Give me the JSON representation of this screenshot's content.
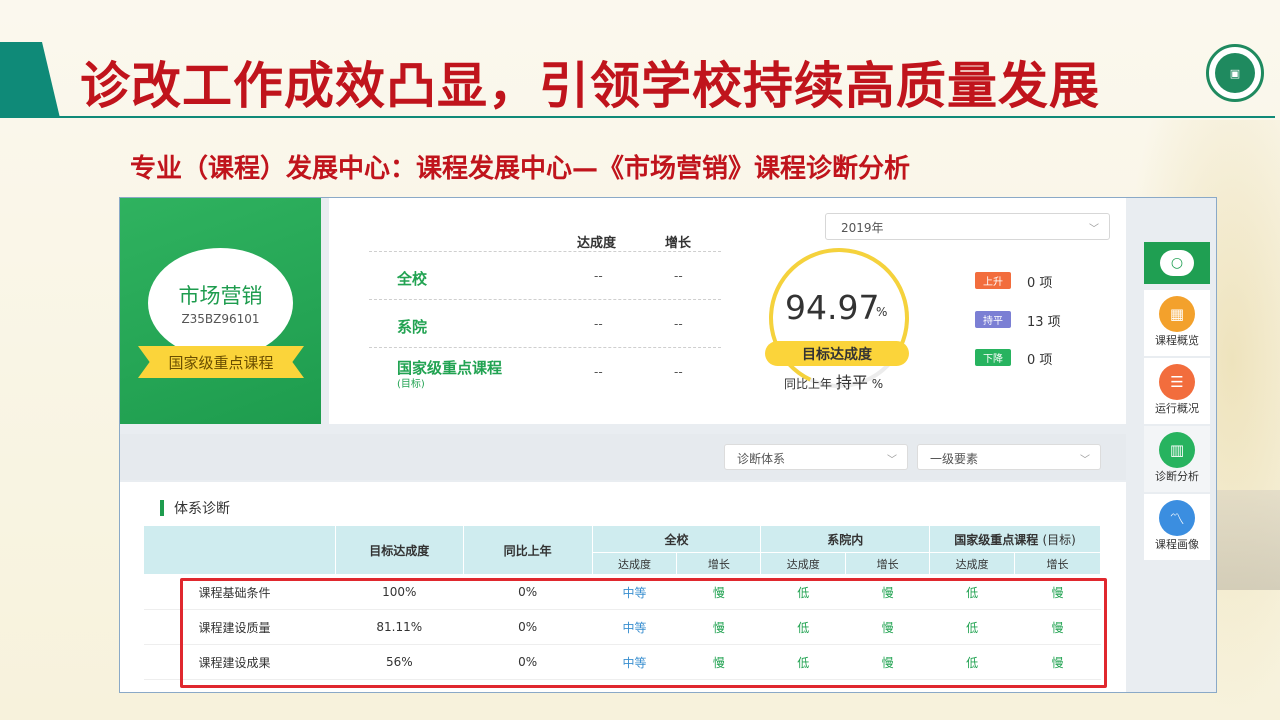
{
  "slide": {
    "title": "诊改工作成效凸显，引领学校持续高质量发展",
    "subtitle": "专业（课程）发展中心：课程发展中心—《市场营销》课程诊断分析"
  },
  "course_card": {
    "name": "市场营销",
    "code": "Z35BZ96101",
    "tag": "国家级重点课程"
  },
  "stats": {
    "col_headers": [
      "达成度",
      "增长"
    ],
    "rows": [
      {
        "label": "全校",
        "sub": "",
        "achievement": "--",
        "growth": "--"
      },
      {
        "label": "系院",
        "sub": "",
        "achievement": "--",
        "growth": "--"
      },
      {
        "label": "国家级重点课程",
        "sub": "(目标)",
        "achievement": "--",
        "growth": "--"
      }
    ]
  },
  "year_select": {
    "value": "2019年"
  },
  "gauge": {
    "value": "94.97",
    "unit": "%",
    "badge": "目标达成度",
    "compare_prefix": "同比上年",
    "compare_value": "持平",
    "compare_unit": "%"
  },
  "trends": [
    {
      "badge": "上升",
      "count": "0 项",
      "color": "#f26d3d"
    },
    {
      "badge": "持平",
      "count": "13 项",
      "color": "#7b7fd4"
    },
    {
      "badge": "下降",
      "count": "0 项",
      "color": "#27b35f"
    }
  ],
  "side_nav": [
    {
      "label": "课程概览",
      "icon": "grid-icon",
      "color": "#f3a12c"
    },
    {
      "label": "运行概况",
      "icon": "list-icon",
      "color": "#f26d3d"
    },
    {
      "label": "诊断分析",
      "icon": "bar-chart-icon",
      "color": "#27b35f"
    },
    {
      "label": "课程画像",
      "icon": "trend-icon",
      "color": "#3b8ee0"
    }
  ],
  "filters": {
    "system": "诊断体系",
    "level": "一级要素"
  },
  "table": {
    "section_title": "体系诊断",
    "headers": {
      "target": "目标达成度",
      "yoy": "同比上年",
      "school": "全校",
      "college": "系院内",
      "national": "国家级重点课程",
      "national_sub": "(目标)",
      "achievement": "达成度",
      "growth": "增长"
    },
    "rows": [
      {
        "name": "课程基础条件",
        "target": "100%",
        "yoy": "0%",
        "school_a": "中等",
        "school_g": "慢",
        "college_a": "低",
        "college_g": "慢",
        "national_a": "低",
        "national_g": "慢"
      },
      {
        "name": "课程建设质量",
        "target": "81.11%",
        "yoy": "0%",
        "school_a": "中等",
        "school_g": "慢",
        "college_a": "低",
        "college_g": "慢",
        "national_a": "低",
        "national_g": "慢"
      },
      {
        "name": "课程建设成果",
        "target": "56%",
        "yoy": "0%",
        "school_a": "中等",
        "school_g": "慢",
        "college_a": "低",
        "college_g": "慢",
        "national_a": "低",
        "national_g": "慢"
      }
    ]
  }
}
